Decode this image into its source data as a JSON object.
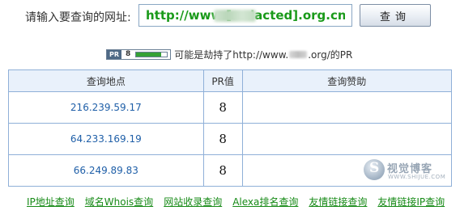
{
  "search": {
    "label": "请输入要查询的网址:",
    "value": "http://www.[redacted].org.cn/",
    "button_label": "查询"
  },
  "pr_notice": {
    "badge_tag": "PR",
    "badge_value": "8",
    "badge_level": 0.8,
    "text_before": "可能是劫持了http://www.",
    "text_after": ".org/的PR"
  },
  "table": {
    "headers": [
      "查询地点",
      "PR值",
      "查询赞助"
    ],
    "rows": [
      {
        "location": "216.239.59.17",
        "pr": "8",
        "sponsor": ""
      },
      {
        "location": "64.233.169.19",
        "pr": "8",
        "sponsor": ""
      },
      {
        "location": "66.249.89.83",
        "pr": "8",
        "sponsor": ""
      }
    ]
  },
  "watermark": {
    "title": "视觉博客",
    "subtitle": "WWW.SHIJUE.COM"
  },
  "links": [
    "IP地址查询",
    "域名Whois查询",
    "网站收录查询",
    "Alexa排名查询",
    "友情链接查询",
    "友情链接IP查询"
  ],
  "colors": {
    "url_text": "#1a9a1a",
    "link": "#168a16",
    "location_text": "#1f5fa8",
    "table_border": "#8fb0d8",
    "header_bg": "#e9f1fb"
  }
}
